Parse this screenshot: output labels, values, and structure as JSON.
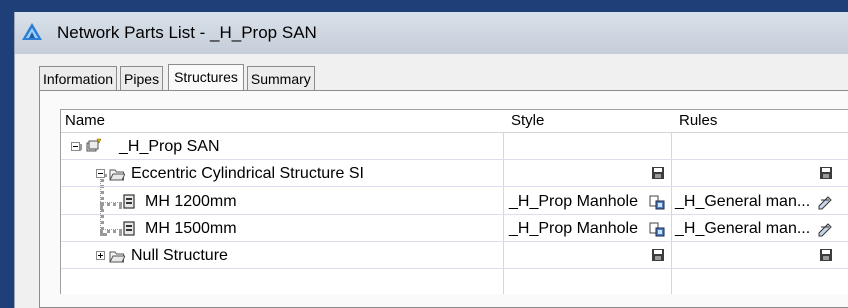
{
  "window": {
    "title": "Network Parts List - _H_Prop SAN"
  },
  "tabs": [
    {
      "label": "Information",
      "active": false
    },
    {
      "label": "Pipes",
      "active": false
    },
    {
      "label": "Structures",
      "active": true
    },
    {
      "label": "Summary",
      "active": false
    }
  ],
  "table": {
    "columns": [
      "Name",
      "Style",
      "Rules"
    ],
    "rows": [
      {
        "name": "_H_Prop SAN",
        "style": "",
        "rules": "",
        "level": 0,
        "icon": "network-icon",
        "expander": "minus"
      },
      {
        "name": "Eccentric Cylindrical Structure SI",
        "style": "",
        "rules": "",
        "level": 1,
        "icon": "folder-icon",
        "expander": "minus"
      },
      {
        "name": "MH 1200mm",
        "style": "_H_Prop Manhole",
        "rules": "_H_General man...",
        "level": 2,
        "icon": "structure-icon"
      },
      {
        "name": "MH 1500mm",
        "style": "_H_Prop Manhole",
        "rules": "_H_General man...",
        "level": 2,
        "icon": "structure-icon"
      },
      {
        "name": "Null Structure",
        "style": "",
        "rules": "",
        "level": 1,
        "icon": "folder-icon",
        "expander": "plus"
      }
    ]
  },
  "colors": {
    "frame": "#1e3f77",
    "titlebar": "#cfd7e1",
    "separator_pink": "#f3c8cf"
  }
}
